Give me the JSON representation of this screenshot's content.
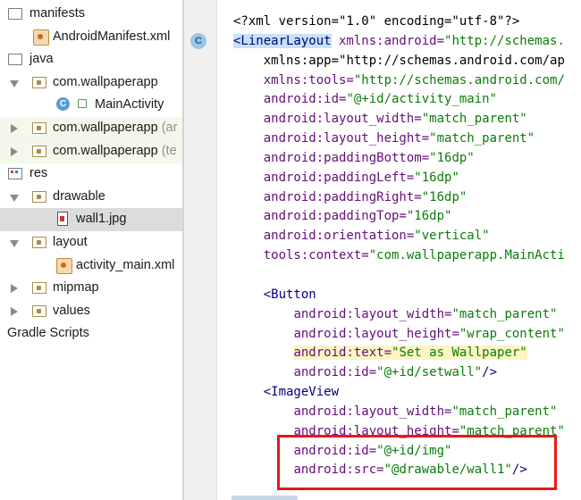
{
  "project_tree": {
    "items": [
      {
        "label": "manifests",
        "dim": ""
      },
      {
        "label": "AndroidManifest.xml",
        "dim": ""
      },
      {
        "label": "java",
        "dim": ""
      },
      {
        "label": "com.wallpaperapp",
        "dim": ""
      },
      {
        "label": "MainActivity",
        "dim": ""
      },
      {
        "label": "com.wallpaperapp",
        "dim": "(ar"
      },
      {
        "label": "com.wallpaperapp",
        "dim": "(te"
      },
      {
        "label": "res",
        "dim": ""
      },
      {
        "label": "drawable",
        "dim": ""
      },
      {
        "label": "wall1.jpg",
        "dim": ""
      },
      {
        "label": "layout",
        "dim": ""
      },
      {
        "label": "activity_main.xml",
        "dim": ""
      },
      {
        "label": "mipmap",
        "dim": ""
      },
      {
        "label": "values",
        "dim": ""
      },
      {
        "label": "Gradle Scripts",
        "dim": ""
      }
    ]
  },
  "editor": {
    "gutter_badge": "C",
    "lines": [
      {
        "lead": "",
        "parts": [
          {
            "t": "<?xml version=\"1.0\" encoding=\"utf-8\"?>",
            "c": "ptxt"
          }
        ]
      },
      {
        "lead": "",
        "parts": [
          {
            "t": "<LinearLayout",
            "c": "tagname hl-bg"
          },
          {
            "t": " xmlns:android=",
            "c": "attr"
          },
          {
            "t": "\"http://schemas.",
            "c": "val"
          }
        ]
      },
      {
        "lead": "    ",
        "parts": [
          {
            "t": "xmlns:app=",
            "c": "ptxt"
          },
          {
            "t": "\"http://schemas.android.com/ap",
            "c": "ptxt"
          }
        ]
      },
      {
        "lead": "    ",
        "parts": [
          {
            "t": "xmlns:tools=",
            "c": "attr"
          },
          {
            "t": "\"http://schemas.android.com/",
            "c": "val"
          }
        ]
      },
      {
        "lead": "    ",
        "parts": [
          {
            "t": "android:id=",
            "c": "attr"
          },
          {
            "t": "\"@+id/activity_main\"",
            "c": "val"
          }
        ]
      },
      {
        "lead": "    ",
        "parts": [
          {
            "t": "android:layout_width=",
            "c": "attr"
          },
          {
            "t": "\"match_parent\"",
            "c": "val"
          }
        ]
      },
      {
        "lead": "    ",
        "parts": [
          {
            "t": "android:layout_height=",
            "c": "attr"
          },
          {
            "t": "\"match_parent\"",
            "c": "val"
          }
        ]
      },
      {
        "lead": "    ",
        "parts": [
          {
            "t": "android:paddingBottom=",
            "c": "attr"
          },
          {
            "t": "\"16dp\"",
            "c": "val"
          }
        ]
      },
      {
        "lead": "    ",
        "parts": [
          {
            "t": "android:paddingLeft=",
            "c": "attr"
          },
          {
            "t": "\"16dp\"",
            "c": "val"
          }
        ]
      },
      {
        "lead": "    ",
        "parts": [
          {
            "t": "android:paddingRight=",
            "c": "attr"
          },
          {
            "t": "\"16dp\"",
            "c": "val"
          }
        ]
      },
      {
        "lead": "    ",
        "parts": [
          {
            "t": "android:paddingTop=",
            "c": "attr"
          },
          {
            "t": "\"16dp\"",
            "c": "val"
          }
        ]
      },
      {
        "lead": "    ",
        "parts": [
          {
            "t": "android:orientation=",
            "c": "attr"
          },
          {
            "t": "\"vertical\"",
            "c": "val"
          }
        ]
      },
      {
        "lead": "    ",
        "parts": [
          {
            "t": "tools:context=",
            "c": "attr"
          },
          {
            "t": "\"com.wallpaperapp.MainActi",
            "c": "val"
          }
        ]
      },
      {
        "lead": "",
        "parts": []
      },
      {
        "lead": "    ",
        "parts": [
          {
            "t": "<Button",
            "c": "tagname"
          }
        ]
      },
      {
        "lead": "        ",
        "parts": [
          {
            "t": "android:layout_width=",
            "c": "attr"
          },
          {
            "t": "\"match_parent\"",
            "c": "val"
          }
        ]
      },
      {
        "lead": "        ",
        "parts": [
          {
            "t": "android:layout_height=",
            "c": "attr"
          },
          {
            "t": "\"wrap_content\"",
            "c": "val"
          }
        ]
      },
      {
        "lead": "        ",
        "parts": [
          {
            "t": "android:text=",
            "c": "attr hl-yellow"
          },
          {
            "t": "\"Set as Wallpaper\"",
            "c": "val hl-yellow"
          }
        ]
      },
      {
        "lead": "        ",
        "parts": [
          {
            "t": "android:id=",
            "c": "attr"
          },
          {
            "t": "\"@+id/setwall\"",
            "c": "val"
          },
          {
            "t": "/>",
            "c": "tagname"
          }
        ]
      },
      {
        "lead": "    ",
        "parts": [
          {
            "t": "<ImageView",
            "c": "tagname"
          }
        ]
      },
      {
        "lead": "        ",
        "parts": [
          {
            "t": "android:layout_width=",
            "c": "attr"
          },
          {
            "t": "\"match_parent\"",
            "c": "val"
          }
        ]
      },
      {
        "lead": "        ",
        "parts": [
          {
            "t": "android:layout_height=",
            "c": "attr"
          },
          {
            "t": "\"match_parent\"",
            "c": "val"
          }
        ]
      },
      {
        "lead": "        ",
        "parts": [
          {
            "t": "android:id=",
            "c": "attr"
          },
          {
            "t": "\"@+id/img\"",
            "c": "val"
          }
        ]
      },
      {
        "lead": "        ",
        "parts": [
          {
            "t": "android:src=",
            "c": "attr"
          },
          {
            "t": "\"@drawable/wall1\"",
            "c": "val"
          },
          {
            "t": "/>",
            "c": "tagname"
          }
        ]
      }
    ]
  },
  "colors": {
    "highlight_box": "#e41a1a",
    "attribute": "#660e7a",
    "value": "#0a7d0a",
    "tag": "#000080"
  }
}
